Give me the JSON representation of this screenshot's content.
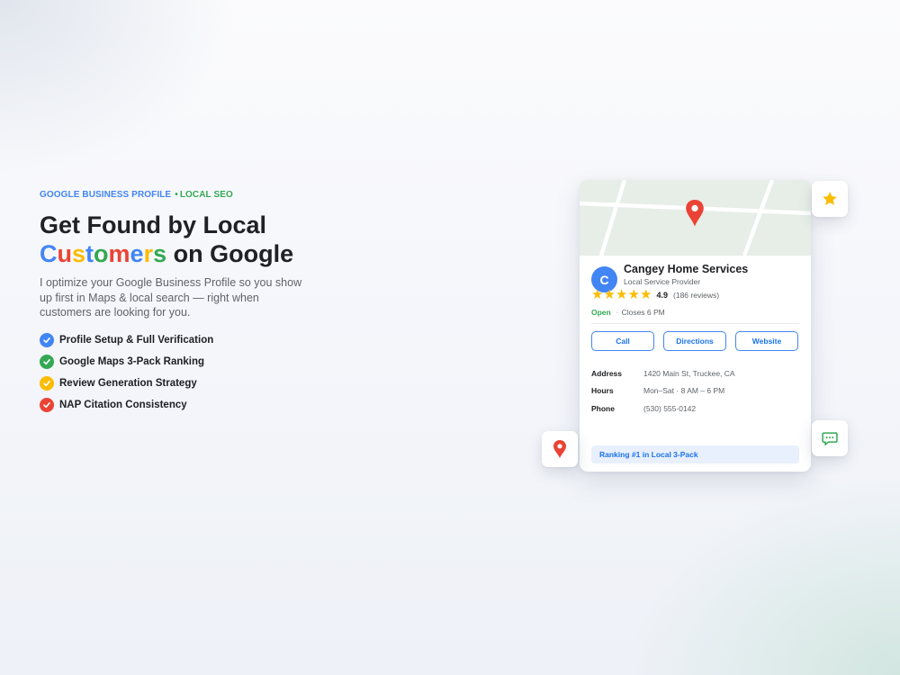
{
  "hero": {
    "eyebrow_primary": "GOOGLE BUSINESS PROFILE",
    "eyebrow_separator": "•",
    "eyebrow_secondary": "LOCAL SEO",
    "headline_line1": "Get Found by Local",
    "headline_colored_word": "Customers",
    "headline_colored_letters": [
      {
        "ch": "C",
        "color": "#4285f4"
      },
      {
        "ch": "u",
        "color": "#ea4335"
      },
      {
        "ch": "s",
        "color": "#fbbc04"
      },
      {
        "ch": "t",
        "color": "#4285f4"
      },
      {
        "ch": "o",
        "color": "#34a853"
      },
      {
        "ch": "m",
        "color": "#ea4335"
      },
      {
        "ch": "e",
        "color": "#4285f4"
      },
      {
        "ch": "r",
        "color": "#fbbc04"
      },
      {
        "ch": "s",
        "color": "#34a853"
      }
    ],
    "headline_line2_rest": " on Google",
    "subtitle": "I optimize your Google Business Profile so you show up first in Maps & local search — right when customers are looking for you.",
    "features": [
      {
        "label": "Profile Setup & Full Verification",
        "check_color": "#4285f4"
      },
      {
        "label": "Google Maps 3-Pack Ranking",
        "check_color": "#34a853"
      },
      {
        "label": "Review Generation Strategy",
        "check_color": "#fbbc04"
      },
      {
        "label": "NAP Citation Consistency",
        "check_color": "#ea4335"
      }
    ]
  },
  "card": {
    "avatar_letter": "C",
    "business_name": "Cangey Home Services",
    "category": "Local Service Provider",
    "stars_count": 5,
    "rating": "4.9",
    "review_count": "(186 reviews)",
    "status_open": "Open",
    "status_separator": "·",
    "status_closes": "Closes 6 PM",
    "actions": {
      "call": "Call",
      "directions": "Directions",
      "website": "Website"
    },
    "details": {
      "address_label": "Address",
      "address_value": "1420 Main St, Truckee, CA",
      "hours_label": "Hours",
      "hours_value": "Mon–Sat · 8 AM – 6 PM",
      "phone_label": "Phone",
      "phone_value": "(530) 555-0142"
    },
    "ranking_badge": "Ranking #1 in Local 3-Pack"
  },
  "icons": {
    "map_marker": "map-pin-icon",
    "star_tile": "star-icon",
    "chat_tile": "chat-bubble-icon",
    "pin_tile": "location-pin-icon",
    "check": "checkmark-icon"
  },
  "colors": {
    "blue": "#4285f4",
    "red": "#ea4335",
    "yellow": "#fbbc04",
    "green": "#34a853",
    "text_dark": "#202124",
    "text_muted": "#5f6368"
  }
}
